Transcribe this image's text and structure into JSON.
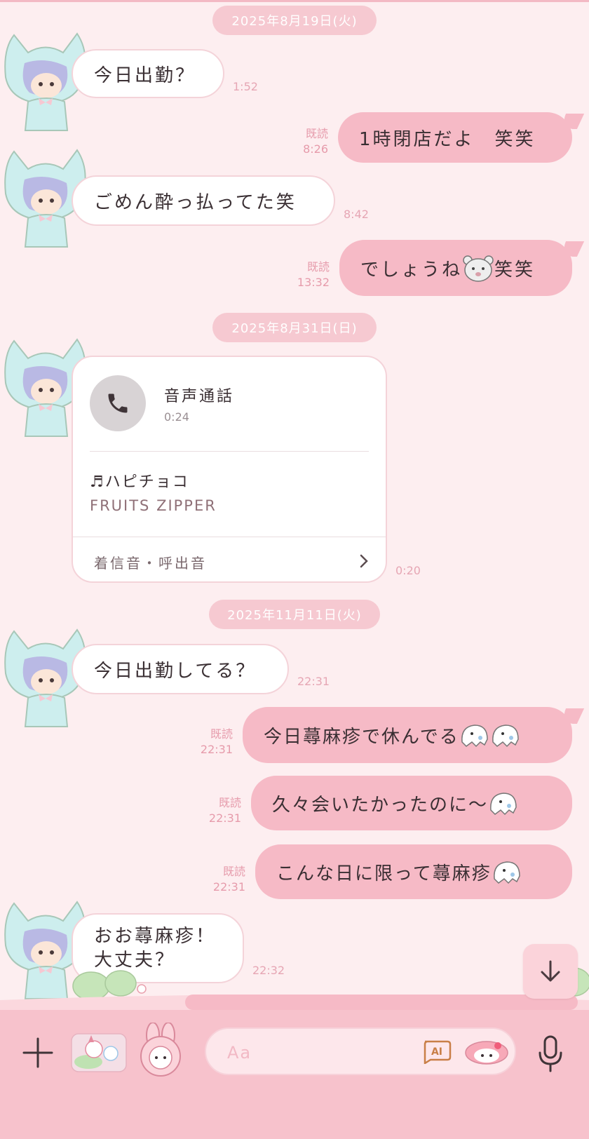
{
  "dates": [
    "2025年8月19日(火)",
    "2025年8月31日(日)",
    "2025年11月11日(火)"
  ],
  "messages": {
    "m1": {
      "text": "今日出勤？",
      "time": "1:52"
    },
    "m2": {
      "text": "1時閉店だよ　笑笑",
      "read": "既読",
      "time": "8:26"
    },
    "m3": {
      "text": "ごめん酔っ払ってた笑",
      "time": "8:42"
    },
    "m4": {
      "text_a": "でしょうね",
      "text_b": "笑笑",
      "read": "既読",
      "time": "13:32"
    },
    "m6": {
      "text": "今日出勤してる？",
      "time": "22:31"
    },
    "m7": {
      "text": "今日蕁麻疹で休んでる",
      "read": "既読",
      "time": "22:31"
    },
    "m8": {
      "text": "久々会いたかったのに〜",
      "read": "既読",
      "time": "22:31"
    },
    "m9": {
      "text": "こんな日に限って蕁麻疹",
      "read": "既読",
      "time": "22:31"
    },
    "m10": {
      "line1": "おお蕁麻疹！",
      "line2": "大丈夫？",
      "time": "22:32"
    }
  },
  "call": {
    "title": "音声通話",
    "duration": "0:24",
    "song": "ハピチョコ",
    "artist": "FRUITS ZIPPER",
    "footer": "着信音・呼出音",
    "time": "0:20"
  },
  "input": {
    "placeholder": "Aa",
    "ai_label": "AI"
  },
  "colors": {
    "bubble_out": "#f6bac6",
    "bubble_in": "#ffffff",
    "background": "#fdeef0",
    "input_bar": "#f7c2cc"
  }
}
